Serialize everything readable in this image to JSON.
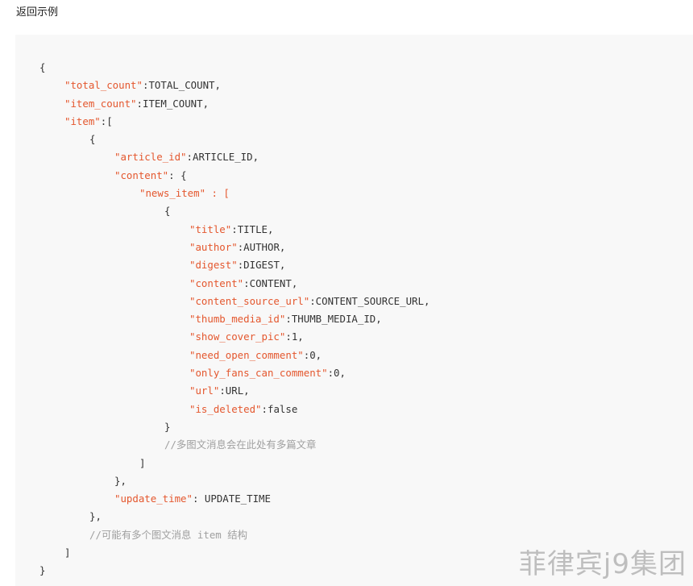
{
  "section": {
    "title": "返回示例"
  },
  "code": {
    "lines": [
      {
        "indent": 0,
        "val": "{"
      },
      {
        "indent": 1,
        "key": "\"total_count\"",
        "sep": ":",
        "val": "TOTAL_COUNT,"
      },
      {
        "indent": 1,
        "key": "\"item_count\"",
        "sep": ":",
        "val": "ITEM_COUNT,"
      },
      {
        "indent": 1,
        "key": "\"item\"",
        "sep": ":",
        "val": "["
      },
      {
        "indent": 2,
        "val": "{"
      },
      {
        "indent": 3,
        "key": "\"article_id\"",
        "sep": ":",
        "val": "ARTICLE_ID,"
      },
      {
        "indent": 3,
        "key": "\"content\"",
        "sep": ": ",
        "val": "{"
      },
      {
        "indent": 4,
        "key": "\"news_item\" : ["
      },
      {
        "indent": 5,
        "val": "{"
      },
      {
        "indent": 6,
        "key": "\"title\"",
        "sep": ":",
        "val": "TITLE,"
      },
      {
        "indent": 6,
        "key": "\"author\"",
        "sep": ":",
        "val": "AUTHOR,"
      },
      {
        "indent": 6,
        "key": "\"digest\"",
        "sep": ":",
        "val": "DIGEST,"
      },
      {
        "indent": 6,
        "key": "\"content\"",
        "sep": ":",
        "val": "CONTENT,"
      },
      {
        "indent": 6,
        "key": "\"content_source_url\"",
        "sep": ":",
        "val": "CONTENT_SOURCE_URL,"
      },
      {
        "indent": 6,
        "key": "\"thumb_media_id\"",
        "sep": ":",
        "val": "THUMB_MEDIA_ID,"
      },
      {
        "indent": 6,
        "key": "\"show_cover_pic\"",
        "sep": ":",
        "val": "1,"
      },
      {
        "indent": 6,
        "key": "\"need_open_comment\"",
        "sep": ":",
        "val": "0,"
      },
      {
        "indent": 6,
        "key": "\"only_fans_can_comment\"",
        "sep": ":",
        "val": "0,"
      },
      {
        "indent": 6,
        "key": "\"url\"",
        "sep": ":",
        "val": "URL,"
      },
      {
        "indent": 6,
        "key": "\"is_deleted\"",
        "sep": ":",
        "val": "false"
      },
      {
        "indent": 5,
        "val": "}"
      },
      {
        "indent": 5,
        "comment": "//多图文消息会在此处有多篇文章"
      },
      {
        "indent": 4,
        "val": "]"
      },
      {
        "indent": 3,
        "val": "},"
      },
      {
        "indent": 3,
        "key": "\"update_time\"",
        "sep": ": ",
        "val": "UPDATE_TIME"
      },
      {
        "indent": 2,
        "val": "},"
      },
      {
        "indent": 2,
        "comment": "//可能有多个图文消息 item 结构"
      },
      {
        "indent": 1,
        "val": "]"
      },
      {
        "indent": 0,
        "val": "}"
      }
    ]
  },
  "watermark": {
    "text": "菲律宾j9集团"
  }
}
